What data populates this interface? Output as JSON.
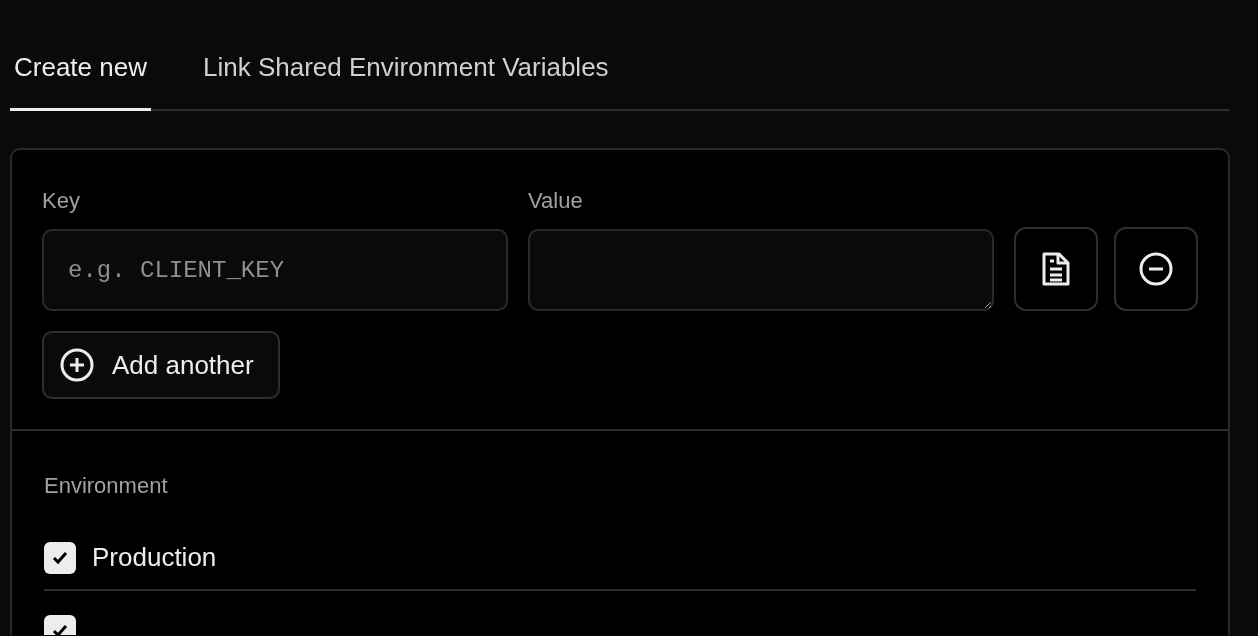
{
  "tabs": [
    {
      "label": "Create new",
      "selected": true
    },
    {
      "label": "Link Shared Environment Variables",
      "selected": false
    }
  ],
  "form": {
    "key_label": "Key",
    "key_placeholder": "e.g. CLIENT_KEY",
    "value_label": "Value",
    "add_button": "Add another"
  },
  "environment": {
    "label": "Environment",
    "options": [
      {
        "label": "Production",
        "checked": true
      },
      {
        "checked": true
      }
    ]
  }
}
